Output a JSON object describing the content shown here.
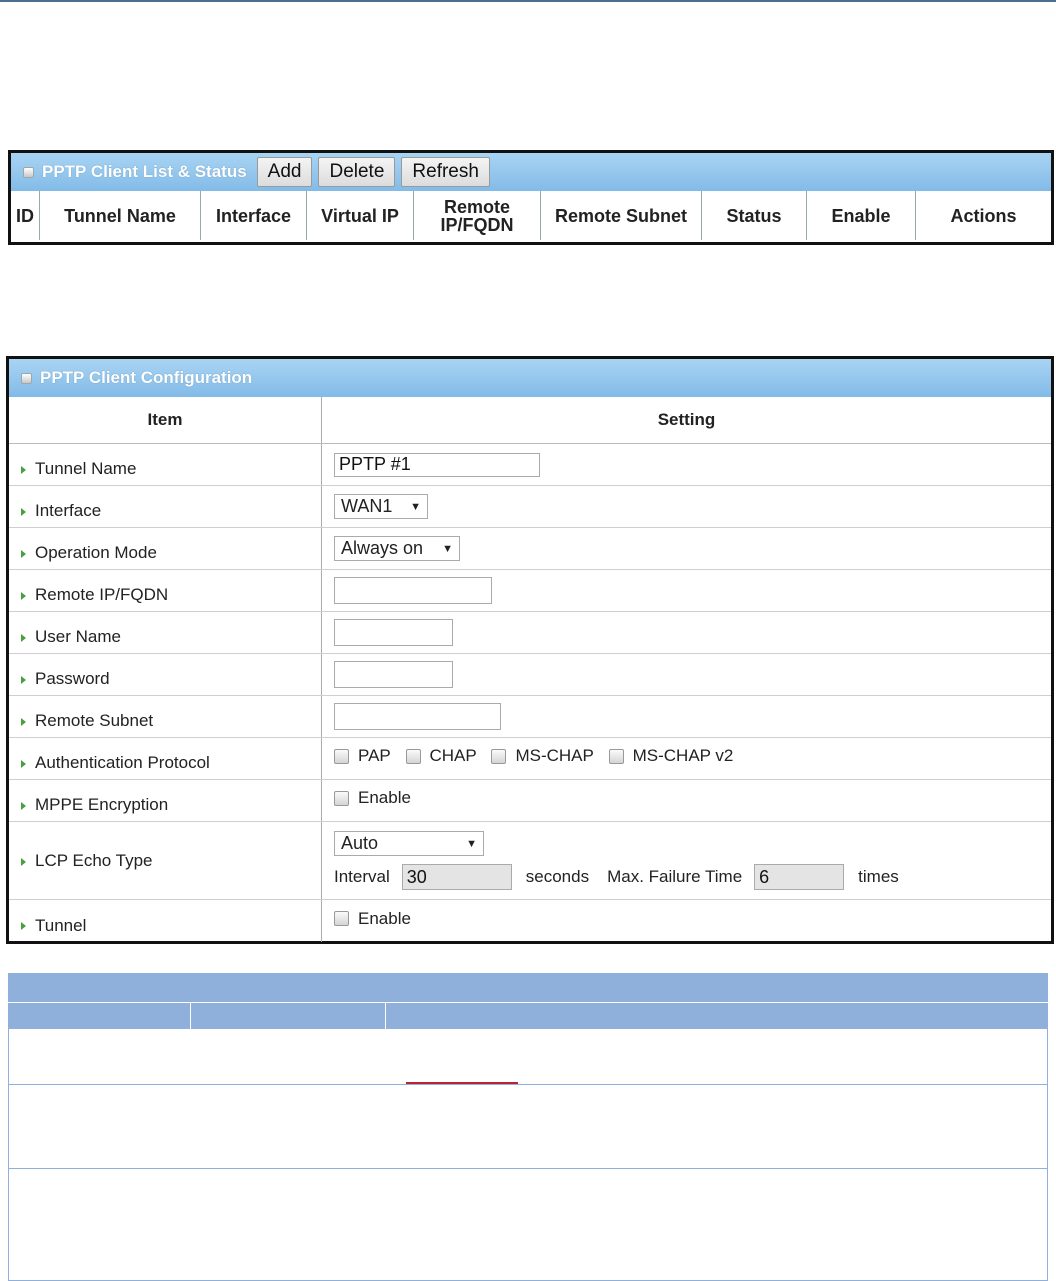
{
  "list_panel": {
    "title": "PPTP Client List & Status",
    "buttons": {
      "add": "Add",
      "delete": "Delete",
      "refresh": "Refresh"
    },
    "columns": [
      "ID",
      "Tunnel Name",
      "Interface",
      "Virtual IP",
      "Remote IP/FQDN",
      "Remote Subnet",
      "Status",
      "Enable",
      "Actions"
    ]
  },
  "config_panel": {
    "title": "PPTP Client Configuration",
    "header": {
      "item": "Item",
      "setting": "Setting"
    },
    "rows": {
      "tunnel_name": {
        "label": "Tunnel Name",
        "value": "PPTP #1"
      },
      "interface": {
        "label": "Interface",
        "value": "WAN1"
      },
      "operation_mode": {
        "label": "Operation Mode",
        "value": "Always on"
      },
      "remote_ip": {
        "label": "Remote IP/FQDN",
        "value": ""
      },
      "user_name": {
        "label": "User Name",
        "value": ""
      },
      "password": {
        "label": "Password",
        "value": ""
      },
      "remote_subnet": {
        "label": "Remote Subnet",
        "value": ""
      },
      "auth_protocol": {
        "label": "Authentication Protocol",
        "options": [
          "PAP",
          "CHAP",
          "MS-CHAP",
          "MS-CHAP v2"
        ]
      },
      "mppe": {
        "label": "MPPE Encryption",
        "option": "Enable"
      },
      "lcp_echo": {
        "label": "LCP Echo Type",
        "value": "Auto",
        "interval_label": "Interval",
        "interval_value": "30",
        "seconds_label": "seconds",
        "max_failure_label": "Max. Failure Time",
        "max_failure_value": "6",
        "times_label": "times"
      },
      "tunnel": {
        "label": "Tunnel",
        "option": "Enable"
      }
    }
  },
  "colors": {
    "header_blue": "#82bbe8",
    "doc_header": "#8eb0da",
    "arrow_green": "#4aa040"
  }
}
